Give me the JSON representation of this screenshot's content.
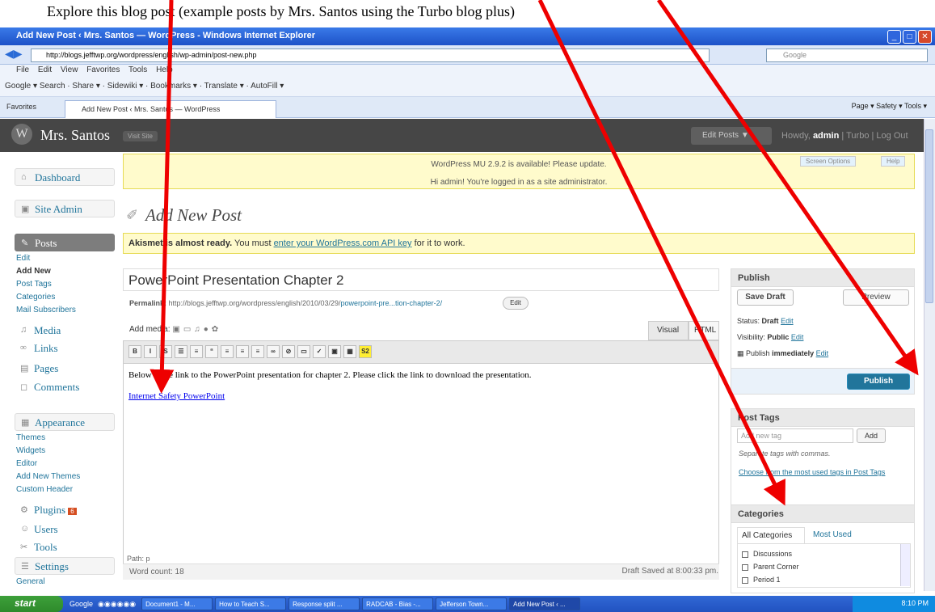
{
  "caption": "Explore this blog post (example posts by Mrs. Santos using the Turbo blog plus)",
  "window": {
    "title": "Add New Post ‹ Mrs. Santos — WordPress - Windows Internet Explorer"
  },
  "browser": {
    "address": "http://blogs.jefftwp.org/wordpress/english/wp-admin/post-new.php",
    "search_placeholder": "Google",
    "menu": [
      "File",
      "Edit",
      "View",
      "Favorites",
      "Tools",
      "Help"
    ],
    "toolbar": "Google  ▾  Search  ·  Share ▾  ·  Sidewiki ▾  ·  Bookmarks ▾  ·  Translate ▾  ·  AutoFill ▾",
    "favorites": "Favorites",
    "tab": "Add New Post ‹ Mrs. Santos — WordPress",
    "tools": "Page ▾  Safety ▾  Tools ▾"
  },
  "wp": {
    "site_name": "Mrs. Santos",
    "visit_site": "Visit Site",
    "edit_posts": "Edit Posts",
    "howdy": "Howdy,",
    "user": "admin",
    "user_links": "| Turbo | Log Out",
    "update_notice": "WordPress MU 2.9.2 is available! Please update.",
    "admin_notice": "Hi admin! You're logged in as a site administrator.",
    "screen_options": "Screen Options",
    "help": "Help",
    "page_title": "Add New Post",
    "akismet_bold": "Akismet is almost ready.",
    "akismet_text": " You must ",
    "akismet_link": "enter your WordPress.com API key",
    "akismet_end": " for it to work.",
    "post_title": "PowerPoint Presentation Chapter 2",
    "permalink_label": "Permalink:",
    "permalink_url": "http://blogs.jefftwp.org/wordpress/english/2010/03/29/",
    "permalink_slug": "powerpoint-pre...tion-chapter-2/",
    "edit": "Edit",
    "add_media": "Add media:",
    "tab_visual": "Visual",
    "tab_html": "HTML",
    "body_text": "Below is the link to the PowerPoint presentation for chapter 2. Please click the link to download the presentation.",
    "body_link": "Internet Safety PowerPoint",
    "path": "Path: p",
    "word_count": "Word count: 18",
    "draft_saved": "Draft Saved at 8:00:33 pm."
  },
  "sidebar": {
    "dashboard": "Dashboard",
    "site_admin": "Site Admin",
    "posts": "Posts",
    "posts_sub": [
      "Edit",
      "Add New",
      "Post Tags",
      "Categories",
      "Mail Subscribers"
    ],
    "media": "Media",
    "links": "Links",
    "pages": "Pages",
    "comments": "Comments",
    "appearance": "Appearance",
    "appearance_sub": [
      "Themes",
      "Widgets",
      "Editor",
      "Add New Themes",
      "Custom Header"
    ],
    "plugins": "Plugins",
    "plugins_badge": "6",
    "users": "Users",
    "tools": "Tools",
    "settings": "Settings",
    "settings_sub": [
      "General"
    ]
  },
  "publish": {
    "title": "Publish",
    "save_draft": "Save Draft",
    "preview": "Preview",
    "status_label": "Status:",
    "status_value": "Draft",
    "visibility_label": "Visibility:",
    "visibility_value": "Public",
    "publish_label": "Publish",
    "publish_value": "immediately",
    "edit": "Edit",
    "publish_button": "Publish"
  },
  "tags": {
    "title": "Post Tags",
    "placeholder": "Add new tag",
    "add": "Add",
    "hint": "Separate tags with commas.",
    "choose": "Choose from the most used tags in Post Tags"
  },
  "categories": {
    "title": "Categories",
    "tab_all": "All Categories",
    "tab_used": "Most Used",
    "items": [
      "Discussions",
      "Parent Corner",
      "Period 1"
    ]
  },
  "taskbar": {
    "start": "start",
    "google": "Google",
    "items": [
      "Document1 - M...",
      "How to Teach S...",
      "Response split ...",
      "RADCAB - Bias -...",
      "Jefferson Town...",
      "Add New Post ‹ ..."
    ],
    "time": "8:10 PM"
  },
  "colors": {
    "annotation_arrow": "#e00000",
    "wp_blue": "#21759b",
    "ie_blue": "#2a5fd3"
  }
}
